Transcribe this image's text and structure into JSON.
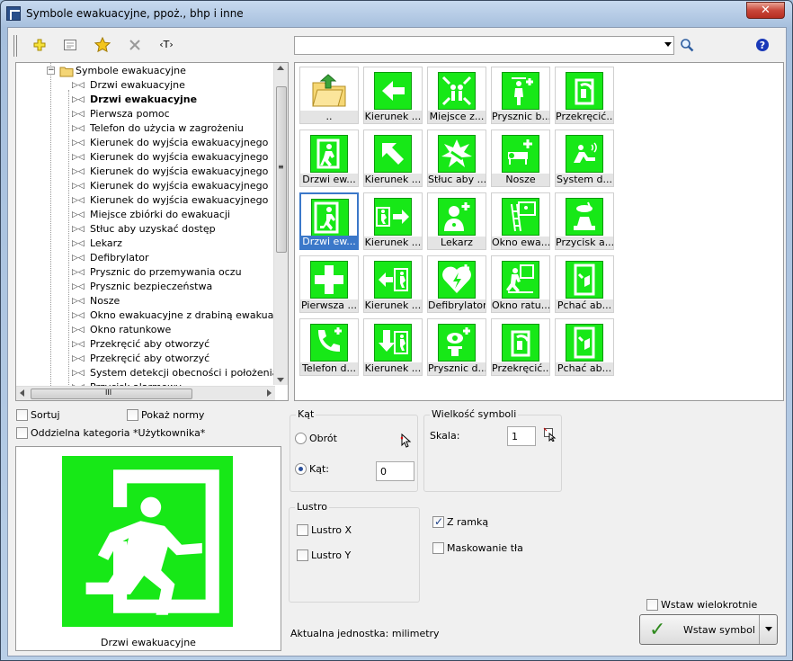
{
  "window": {
    "title": "Symbole ewakuacyjne, ppoż., bhp i inne",
    "close_glyph": "✕"
  },
  "toolbar": {
    "icons": [
      "add-icon",
      "properties-icon",
      "favorite-star-icon",
      "delete-icon",
      "text-tag-icon"
    ],
    "text_tag_label": "‹T›",
    "search_value": "",
    "search_icon": "search-icon",
    "help_icon": "help-icon"
  },
  "tree": {
    "root": {
      "label": "Symbole ewakuacyjne"
    },
    "items": [
      "Drzwi ewakuacyjne",
      "Drzwi ewakuacyjne",
      "Pierwsza pomoc",
      "Telefon do użycia w zagrożeniu",
      "Kierunek do wyjścia ewakuacyjnego",
      "Kierunek do wyjścia ewakuacyjnego",
      "Kierunek do wyjścia ewakuacyjnego",
      "Kierunek do wyjścia ewakuacyjnego",
      "Kierunek do wyjścia ewakuacyjnego",
      "Miejsce zbiórki do ewakuacji",
      "Stłuc aby uzyskać dostęp",
      "Lekarz",
      "Defibrylator",
      "Prysznic do przemywania oczu",
      "Prysznic bezpieczeństwa",
      "Nosze",
      "Okno ewakuacyjne z drabiną ewakuacyjną",
      "Okno ratunkowe",
      "Przekręcić aby otworzyć",
      "Przekręcić aby otworzyć",
      "System detekcji obecności i położenia fotel",
      "Przycisk alarmowy"
    ],
    "selected_index": 1,
    "hscroll_glyph": "III",
    "vscroll_glyph": "≡"
  },
  "grid": {
    "cells": [
      {
        "label": "..",
        "icon": "folder-up-icon"
      },
      {
        "label": "Kierunek ...",
        "icon": "arrow-left-icon"
      },
      {
        "label": "Miejsce z...",
        "icon": "assembly-point-icon"
      },
      {
        "label": "Prysznic b...",
        "icon": "safety-shower-icon"
      },
      {
        "label": "Przekręcić...",
        "icon": "turn-to-open-icon"
      },
      {
        "label": "Drzwi ew...",
        "icon": "exit-door-icon"
      },
      {
        "label": "Kierunek ...",
        "icon": "arrow-up-left-icon"
      },
      {
        "label": "Stłuc aby ...",
        "icon": "break-glass-icon"
      },
      {
        "label": "Nosze",
        "icon": "stretcher-icon"
      },
      {
        "label": "System d...",
        "icon": "detection-system-icon"
      },
      {
        "label": "Drzwi ew...",
        "icon": "running-man-icon"
      },
      {
        "label": "Kierunek ...",
        "icon": "exit-arrow-right-icon"
      },
      {
        "label": "Lekarz",
        "icon": "doctor-icon"
      },
      {
        "label": "Okno ewa...",
        "icon": "escape-ladder-icon"
      },
      {
        "label": "Przycisk a...",
        "icon": "alarm-button-icon"
      },
      {
        "label": "Pierwsza ...",
        "icon": "first-aid-cross-icon"
      },
      {
        "label": "Kierunek ...",
        "icon": "exit-arrow-left-icon"
      },
      {
        "label": "Defibrylator",
        "icon": "defibrillator-icon"
      },
      {
        "label": "Okno ratu...",
        "icon": "rescue-window-icon"
      },
      {
        "label": "Pchać ab...",
        "icon": "push-door-icon"
      },
      {
        "label": "Telefon d...",
        "icon": "emergency-phone-icon"
      },
      {
        "label": "Kierunek ...",
        "icon": "arrow-down-exit-icon"
      },
      {
        "label": "Prysznic d...",
        "icon": "eye-shower-icon"
      },
      {
        "label": "Przekręcić...",
        "icon": "turn-to-open-icon"
      },
      {
        "label": "Pchać ab...",
        "icon": "push-door-icon"
      }
    ],
    "selected_index": 10
  },
  "options": {
    "sortuj": "Sortuj",
    "pokaz_normy": "Pokaż normy",
    "oddzielna": "Oddzielna kategoria *Użytkownika*"
  },
  "preview": {
    "caption": "Drzwi ewakuacyjne",
    "icon": "running-man-exit-icon"
  },
  "angle": {
    "title": "Kąt",
    "rotation": "Obrót",
    "angle": "Kąt:",
    "angle_value": "0",
    "selected": "angle"
  },
  "size": {
    "title": "Wielkość symboli",
    "scale_label": "Skala:",
    "scale_value": "1"
  },
  "mirror": {
    "title": "Lustro",
    "x": "Lustro X",
    "y": "Lustro Y"
  },
  "frame": {
    "z_ramka": "Z ramką",
    "z_ramka_checked": true,
    "maskowanie": "Maskowanie tła",
    "maskowanie_checked": false
  },
  "unit": "Aktualna jednostka: milimetry",
  "insert": {
    "multi": "Wstaw wielokrotnie",
    "button": "Wstaw symbol"
  },
  "colors": {
    "sign_green": "#17e817",
    "selection_blue": "#3b78c9"
  }
}
